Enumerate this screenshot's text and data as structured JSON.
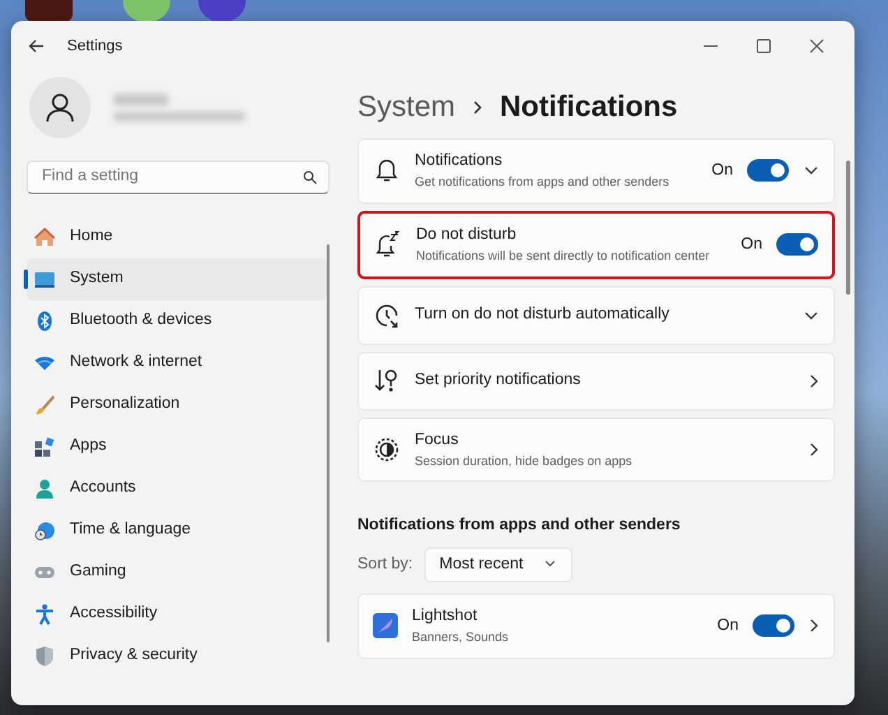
{
  "window": {
    "title": "Settings"
  },
  "sidebar": {
    "search": {
      "placeholder": "Find a setting"
    },
    "items": [
      {
        "label": "Home",
        "kind": "home",
        "selected": false
      },
      {
        "label": "System",
        "kind": "system",
        "selected": true
      },
      {
        "label": "Bluetooth & devices",
        "kind": "bluetooth",
        "selected": false
      },
      {
        "label": "Network & internet",
        "kind": "network",
        "selected": false
      },
      {
        "label": "Personalization",
        "kind": "brush",
        "selected": false
      },
      {
        "label": "Apps",
        "kind": "apps",
        "selected": false
      },
      {
        "label": "Accounts",
        "kind": "accounts",
        "selected": false
      },
      {
        "label": "Time & language",
        "kind": "time",
        "selected": false
      },
      {
        "label": "Gaming",
        "kind": "gaming",
        "selected": false
      },
      {
        "label": "Accessibility",
        "kind": "accessibility",
        "selected": false
      },
      {
        "label": "Privacy & security",
        "kind": "privacy",
        "selected": false
      }
    ]
  },
  "breadcrumb": [
    "System",
    "Notifications"
  ],
  "settings": [
    {
      "kind": "bell",
      "title": "Notifications",
      "description": "Get notifications from apps and other senders",
      "toggle": {
        "on": true,
        "label": "On"
      },
      "expandable": true,
      "highlighted": false
    },
    {
      "kind": "bell-snooze",
      "title": "Do not disturb",
      "description": "Notifications will be sent directly to notification center",
      "toggle": {
        "on": true,
        "label": "On"
      },
      "highlighted": true
    },
    {
      "kind": "clock",
      "title": "Turn on do not disturb automatically",
      "expandable": true,
      "highlighted": false
    },
    {
      "kind": "priority",
      "title": "Set priority notifications",
      "opens_page": true,
      "highlighted": false
    },
    {
      "kind": "focus",
      "title": "Focus",
      "description": "Session duration, hide badges on apps",
      "opens_page": true,
      "highlighted": false
    }
  ],
  "apps_section": {
    "heading": "Notifications from apps and other senders",
    "sort_label": "Sort by:",
    "sort_value": "Most recent",
    "apps": [
      {
        "name": "Lightshot",
        "description": "Banners, Sounds",
        "toggle": {
          "on": true,
          "label": "On"
        },
        "opens_page": true
      }
    ]
  }
}
